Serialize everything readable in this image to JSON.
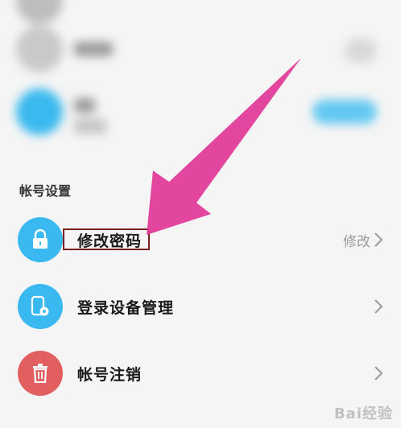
{
  "section": {
    "title": "帐号设置"
  },
  "rows": [
    {
      "label": "修改密码",
      "value": "修改",
      "icon": "lock-icon"
    },
    {
      "label": "登录设备管理",
      "value": "",
      "icon": "device-settings-icon"
    },
    {
      "label": "帐号注销",
      "value": "",
      "icon": "trash-icon"
    }
  ],
  "watermark": "Bai经验",
  "colors": {
    "accent_blue": "#39b9ef",
    "danger_red": "#e25f5f",
    "arrow_pink": "#e03c9a",
    "highlight_border": "#7a1f1f"
  }
}
